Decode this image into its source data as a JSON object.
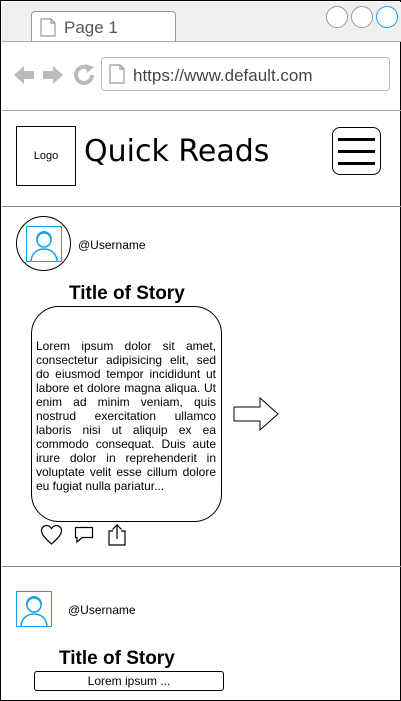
{
  "browser": {
    "tab_title": "Page 1",
    "url": "https://www.default.com"
  },
  "header": {
    "logo_label": "Logo",
    "app_title": "Quick Reads"
  },
  "posts": [
    {
      "username": "@Username",
      "title": "Title of Story",
      "excerpt": "Lorem ipsum dolor sit amet, consectetur adipisicing elit, sed do eiusmod tempor incididunt ut labore et dolore magna aliqua. Ut enim ad minim veniam, quis nostrud exercitation ullamco laboris nisi ut aliquip ex ea commodo consequat. Duis aute irure dolor in reprehenderit in voluptate velit esse cillum dolore eu fugiat nulla pariatur..."
    },
    {
      "username": "@Username",
      "title": "Title of Story",
      "excerpt": "Lorem ipsum ..."
    }
  ],
  "colors": {
    "accent": "#1ba1e2",
    "icon_gray": "#bbbbbb"
  }
}
